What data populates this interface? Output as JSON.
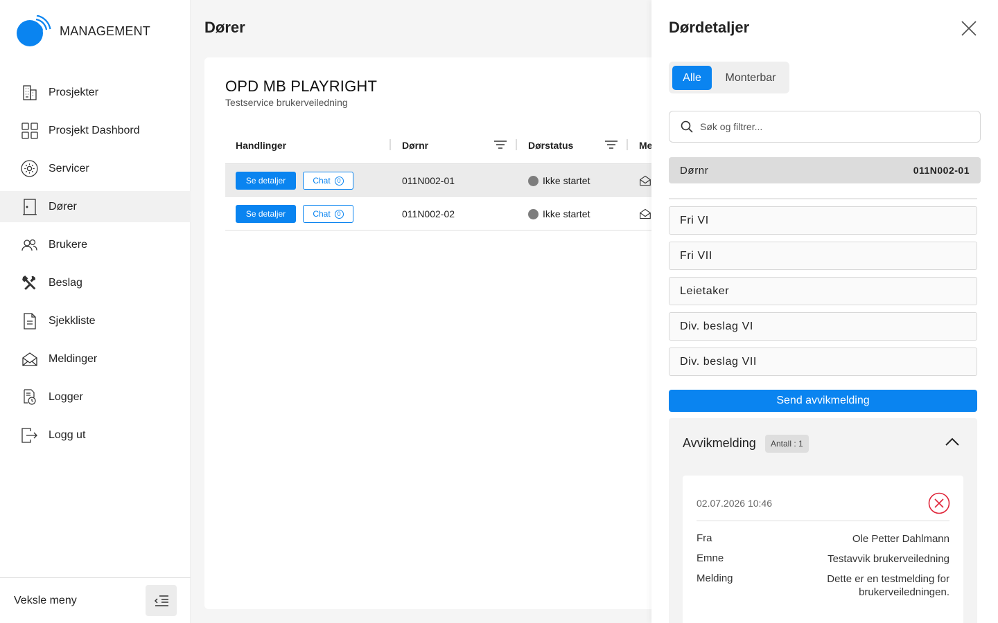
{
  "app": {
    "logo_text": "MANAGEMENT"
  },
  "nav": {
    "items": [
      {
        "label": "Prosjekter"
      },
      {
        "label": "Prosjekt Dashbord"
      },
      {
        "label": "Servicer"
      },
      {
        "label": "Dører"
      },
      {
        "label": "Brukere"
      },
      {
        "label": "Beslag"
      },
      {
        "label": "Sjekkliste"
      },
      {
        "label": "Meldinger"
      },
      {
        "label": "Logger"
      },
      {
        "label": "Logg ut"
      }
    ],
    "active_index": 3,
    "footer_label": "Veksle meny"
  },
  "main": {
    "page_title": "Dører",
    "card_title": "OPD MB PLAYRIGHT",
    "card_subtitle": "Testservice brukerveiledning",
    "columns": [
      "Handlinger",
      "Dørnr",
      "Dørstatus",
      "Me"
    ],
    "rows": [
      {
        "details_label": "Se detaljer",
        "chat_label": "Chat",
        "chat_count": "0",
        "dornr": "011N002-01",
        "status": "Ikke startet"
      },
      {
        "details_label": "Se detaljer",
        "chat_label": "Chat",
        "chat_count": "0",
        "dornr": "011N002-02",
        "status": "Ikke startet"
      }
    ]
  },
  "panel": {
    "title": "Dørdetaljer",
    "tabs": [
      "Alle",
      "Monterbar"
    ],
    "search_placeholder": "Søk og filtrer...",
    "dornr_label": "Dørnr",
    "dornr_value": "011N002-01",
    "fields": [
      "Fri VI",
      "Fri VII",
      "Leietaker",
      "Div. beslag VI",
      "Div. beslag VII"
    ],
    "send_button": "Send avvikmelding",
    "accordion": {
      "title": "Avvikmelding",
      "badge": "Antall :  1",
      "message": {
        "date": "02.07.2026 10:46",
        "from_label": "Fra",
        "from_value": "Ole Petter Dahlmann",
        "subject_label": "Emne",
        "subject_value": "Testavvik brukerveiledning",
        "message_label": "Melding",
        "message_value": "Dette er en testmelding for brukerveiledningen."
      }
    }
  },
  "colors": {
    "accent": "#0a84f0",
    "status_grey": "#7d7d7d",
    "danger": "#e0283c"
  }
}
